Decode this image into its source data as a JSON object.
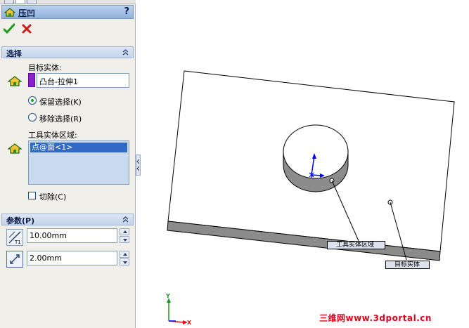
{
  "titlebar": {
    "title": "压凹",
    "help": "?"
  },
  "actions": {
    "ok_icon": "checkmark-icon",
    "cancel_icon": "x-icon"
  },
  "selection_section": {
    "title": "选择",
    "target_label": "目标实体:",
    "target_value": "凸台-拉伸1",
    "target_color": "#8a1fd0",
    "keep_label": "保留选择(K)",
    "remove_label": "移除选择(R)",
    "keep_selected": true,
    "tool_label": "工具实体区域:",
    "tool_items": [
      "点@面<1>"
    ],
    "cut_label": "切除(C)",
    "cut_checked": false
  },
  "params_section": {
    "title": "参数(P)",
    "thickness_value": "10.00mm",
    "clearance_value": "2.00mm"
  },
  "viewport": {
    "callout_tool": "工具实体区域",
    "callout_target": "目标实体",
    "axis_x": "X",
    "axis_y": "Y"
  },
  "watermark": "三维网www.3dportal.cn",
  "colors": {
    "accent": "#316ac5",
    "panel_bg": "#f0efe9",
    "watermark": "#e0001a"
  }
}
